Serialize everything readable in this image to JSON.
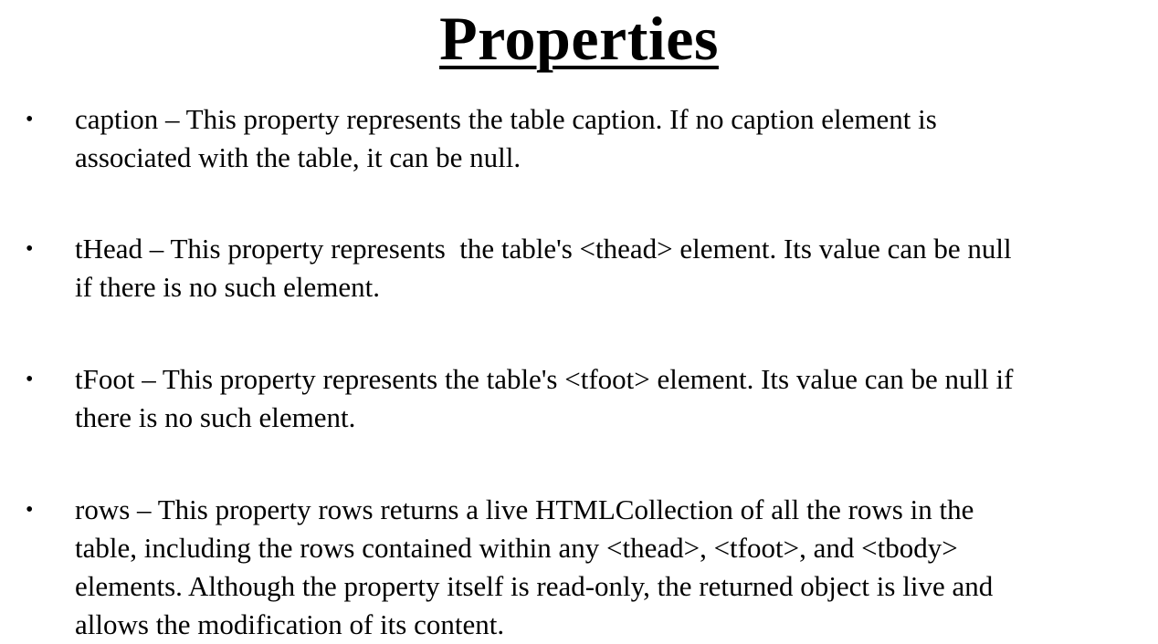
{
  "title": "Properties",
  "bullets": [
    {
      "lines": [
        "caption – This property represents the table caption. If no caption element is",
        "associated with the table, it can be null."
      ]
    },
    {
      "lines": [
        "tHead – This property represents  the table's <thead> element. Its value can be null",
        "if there is no such element."
      ]
    },
    {
      "lines": [
        "tFoot – This property represents the table's <tfoot> element. Its value can be null if",
        "there is no such element."
      ]
    },
    {
      "lines": [
        "rows – This property rows returns a live HTMLCollection of all the rows in the",
        "table, including the rows contained within any <thead>, <tfoot>, and <tbody>",
        "elements. Although the property itself is read-only, the returned object is live and",
        "allows the modification of its content."
      ]
    }
  ],
  "bullet_glyph": "•"
}
